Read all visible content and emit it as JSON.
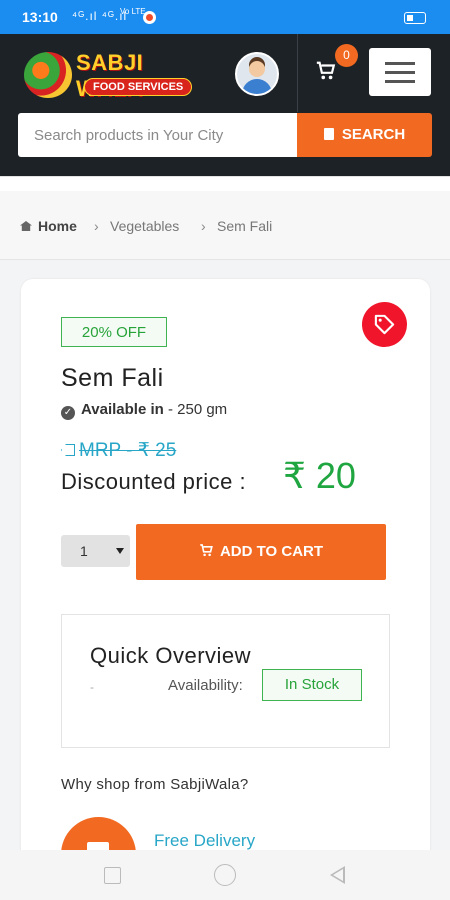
{
  "status_bar": {
    "time": "13:10",
    "signal": "⁴ᴳ.ıl ⁴ᴳ.ıl",
    "volte": "Vo LTE"
  },
  "header": {
    "brand_name": "SABJI WALA",
    "brand_sub": "FOOD SERVICES",
    "cart_count": "0",
    "search_placeholder": "Search products in Your City",
    "search_button": "SEARCH"
  },
  "breadcrumb": {
    "home": "Home",
    "category": "Vegetables",
    "current": "Sem Fali",
    "sep": "›"
  },
  "product": {
    "discount_badge": "20% OFF",
    "title": "Sem Fali",
    "available_label": "Available in",
    "available_value": " - 250 gm",
    "mrp": "MRP - ₹ 25",
    "discounted_label": "Discounted price :",
    "discounted_price": "₹ 20",
    "quantity": "1",
    "add_to_cart": "ADD TO CART"
  },
  "overview": {
    "title": "Quick Overview",
    "dash": "-",
    "availability_label": "Availability:",
    "availability_value": "In Stock"
  },
  "why": {
    "heading": "Why shop from SabjiWala?",
    "features": [
      {
        "label": "Free Delivery",
        "icon": "truck-icon"
      }
    ]
  },
  "colors": {
    "accent": "#f26a21",
    "header_bg": "#1d2226",
    "price_green": "#1fa640",
    "status_bar": "#1b8cf0"
  }
}
